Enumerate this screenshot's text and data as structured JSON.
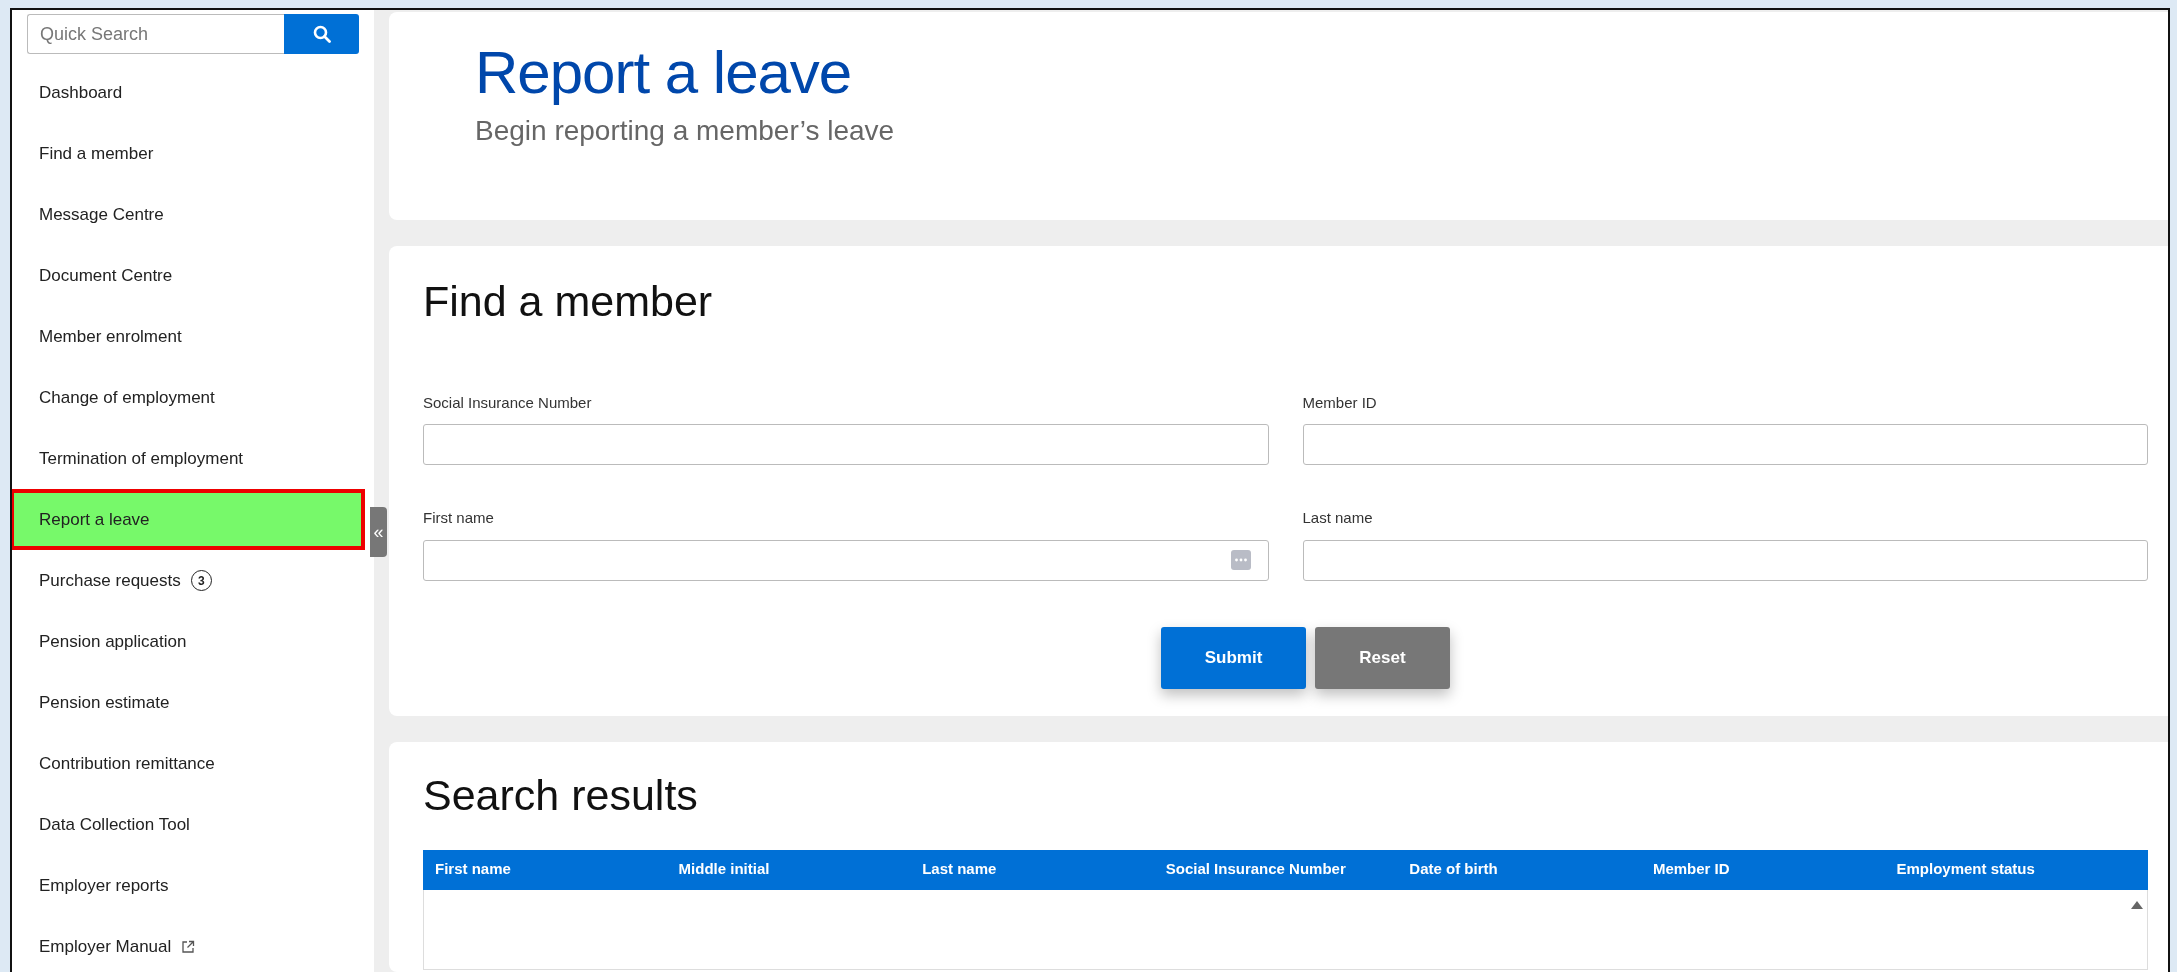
{
  "sidebar": {
    "search": {
      "placeholder": "Quick Search"
    },
    "items": [
      {
        "label": "Dashboard",
        "selected": false
      },
      {
        "label": "Find a member",
        "selected": false
      },
      {
        "label": "Message Centre",
        "selected": false
      },
      {
        "label": "Document Centre",
        "selected": false
      },
      {
        "label": "Member enrolment",
        "selected": false
      },
      {
        "label": "Change of employment",
        "selected": false
      },
      {
        "label": "Termination of employment",
        "selected": false
      },
      {
        "label": "Report a leave",
        "selected": true
      },
      {
        "label": "Purchase requests",
        "selected": false,
        "badge": "3"
      },
      {
        "label": "Pension application",
        "selected": false
      },
      {
        "label": "Pension estimate",
        "selected": false
      },
      {
        "label": "Contribution remittance",
        "selected": false
      },
      {
        "label": "Data Collection Tool",
        "selected": false
      },
      {
        "label": "Employer reports",
        "selected": false
      },
      {
        "label": "Employer Manual",
        "selected": false,
        "external": true
      }
    ],
    "collapse_label": "«"
  },
  "header": {
    "title": "Report a leave",
    "subtitle": "Begin reporting a member’s leave"
  },
  "find_member": {
    "title": "Find a member",
    "fields": [
      {
        "label": "Social Insurance Number"
      },
      {
        "label": "Member ID"
      },
      {
        "label": "First name",
        "kind": "lookup"
      },
      {
        "label": "Last name"
      }
    ],
    "buttons": [
      {
        "label": "Submit",
        "kind": "primary"
      },
      {
        "label": "Reset",
        "kind": "secondary"
      }
    ]
  },
  "search_results": {
    "title": "Search results",
    "columns": [
      "First name",
      "Middle initial",
      "Last name",
      "Social Insurance Number",
      "Date of birth",
      "Member ID",
      "Employment status"
    ]
  }
}
